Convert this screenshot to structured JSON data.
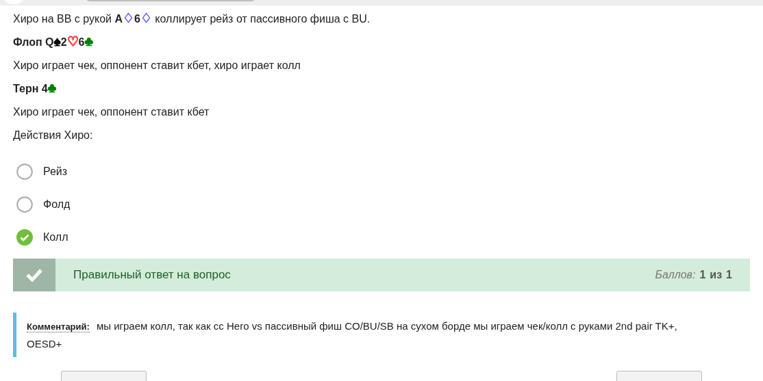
{
  "question": [
    {
      "kind": "plain",
      "parts": [
        {
          "kind": "text",
          "text": "Хиро на BB с рукой **A**"
        },
        {
          "kind": "suit",
          "text": "♢",
          "color": "#6666ff"
        },
        {
          "kind": "text",
          "text": "**6**"
        },
        {
          "kind": "suit",
          "text": "♢",
          "color": "#6666ff"
        },
        {
          "kind": "text",
          "text": " коллирует рейз от пассивного фиша с BU."
        }
      ]
    },
    {
      "kind": "heading",
      "parts": [
        {
          "kind": "text",
          "text": "Флоп Q"
        },
        {
          "kind": "suit",
          "text": "♠",
          "color": "#000000"
        },
        {
          "kind": "text",
          "text": "2"
        },
        {
          "kind": "suit",
          "text": "♡",
          "color": "#ff4444"
        },
        {
          "kind": "text",
          "text": "6"
        },
        {
          "kind": "suit",
          "text": "♣",
          "color": "#008000"
        }
      ]
    },
    {
      "kind": "plain",
      "parts": [
        {
          "kind": "text",
          "text": "Хиро играет чек, оппонент ставит кбет, хиро играет колл"
        }
      ]
    },
    {
      "kind": "heading",
      "parts": [
        {
          "kind": "text",
          "text": "Терн 4"
        },
        {
          "kind": "suit",
          "text": "♣",
          "color": "#008000"
        }
      ]
    },
    {
      "kind": "plain",
      "parts": [
        {
          "kind": "text",
          "text": "Хиро играет чек, оппонент ставит кбет"
        }
      ]
    },
    {
      "kind": "plain",
      "parts": [
        {
          "kind": "text",
          "text": "Действия Хиро:"
        }
      ]
    }
  ],
  "options": [
    {
      "label": "Рейз",
      "selected": false
    },
    {
      "label": "Фолд",
      "selected": false
    },
    {
      "label": "Колл",
      "selected": true
    }
  ],
  "feedback": {
    "correct": true,
    "message": "Правильный ответ на вопрос",
    "score_label": "Баллов:",
    "score": "1",
    "of": "из",
    "max": "1"
  },
  "comment": {
    "label": "Комментарий:",
    "text": "мы играем колл, так как cc Hero vs пассивный фиш CO/BU/SB на сухом борде мы играем чек/колл с руками 2nd pair TK+, OESD+"
  }
}
